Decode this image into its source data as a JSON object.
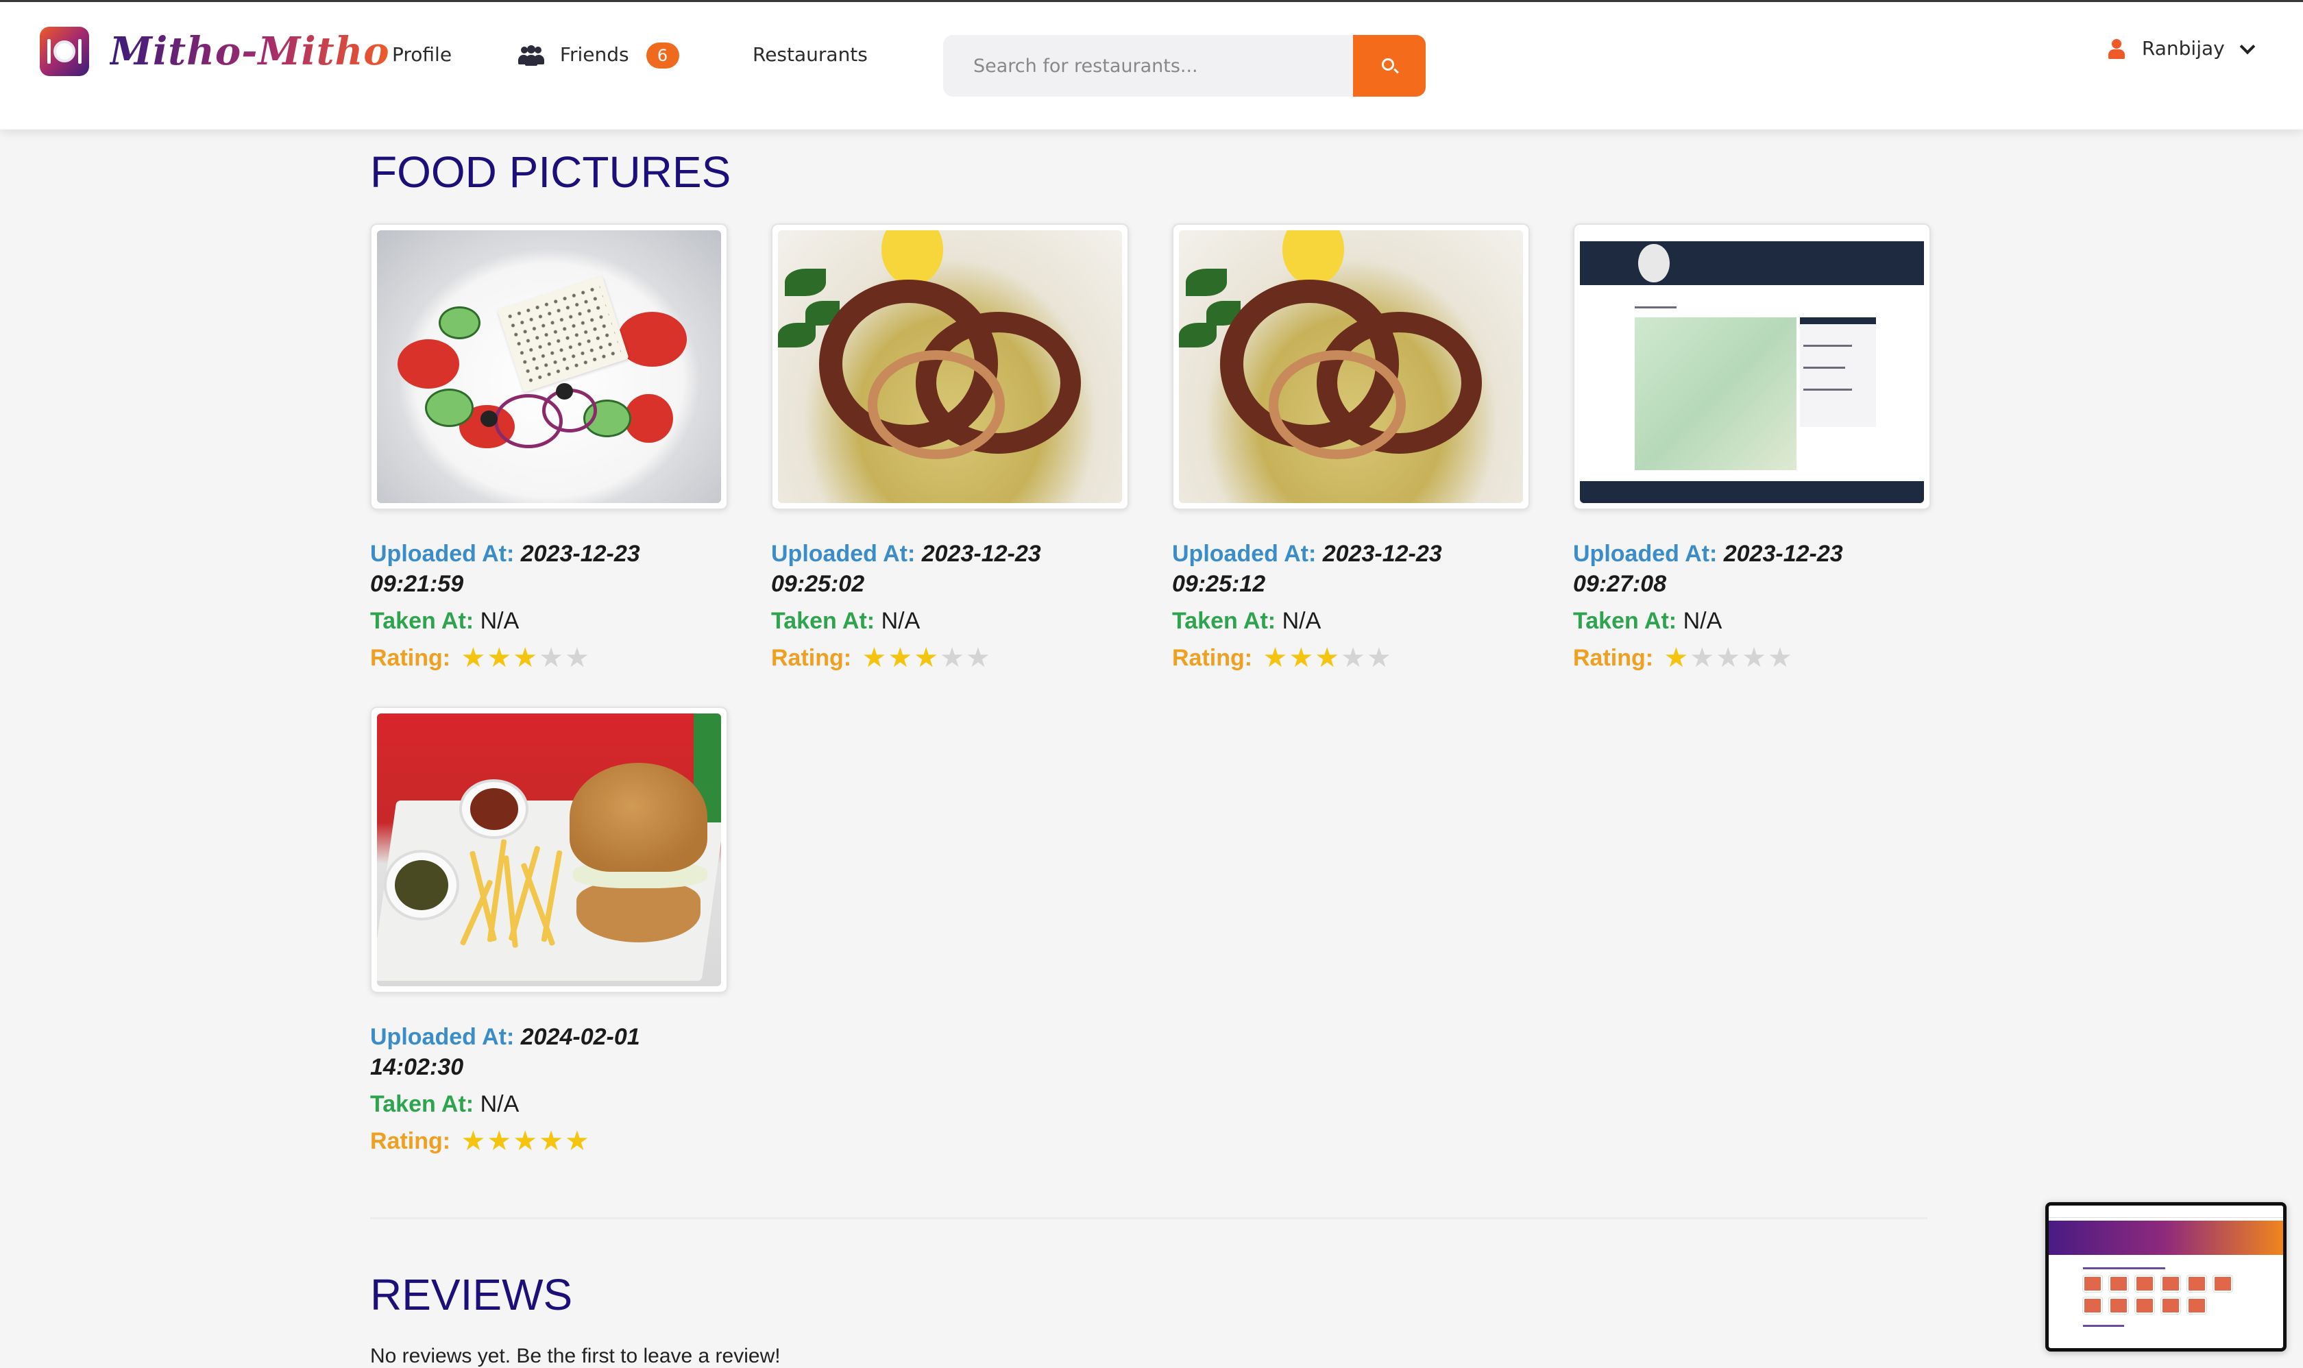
{
  "app": {
    "brand": "Mitho-Mitho"
  },
  "nav": {
    "profile": "Profile",
    "friends": "Friends",
    "friends_count": "6",
    "restaurants": "Restaurants",
    "search_placeholder": "Search for restaurants...",
    "user": "Ranbijay"
  },
  "food_pictures": {
    "title": "FOOD PICTURES",
    "labels": {
      "uploaded": "Uploaded At:",
      "taken": "Taken At:",
      "rating": "Rating:"
    },
    "items": [
      {
        "image": "greek-salad",
        "uploaded_date": "2023-12-23",
        "uploaded_time": "09:21:59",
        "taken": "N/A",
        "rating": 3,
        "rating_max": 5
      },
      {
        "image": "grilled-octopus",
        "uploaded_date": "2023-12-23",
        "uploaded_time": "09:25:02",
        "taken": "N/A",
        "rating": 3,
        "rating_max": 5
      },
      {
        "image": "grilled-octopus",
        "uploaded_date": "2023-12-23",
        "uploaded_time": "09:25:12",
        "taken": "N/A",
        "rating": 3,
        "rating_max": 5
      },
      {
        "image": "profile-map-screenshot",
        "uploaded_date": "2023-12-23",
        "uploaded_time": "09:27:08",
        "taken": "N/A",
        "rating": 1,
        "rating_max": 5
      },
      {
        "image": "burger-and-fries",
        "uploaded_date": "2024-02-01",
        "uploaded_time": "14:02:30",
        "taken": "N/A",
        "rating": 5,
        "rating_max": 5
      }
    ]
  },
  "reviews": {
    "title": "REVIEWS",
    "empty_text": "No reviews yet. Be the first to leave a review!"
  },
  "colors": {
    "accent": "#f46b1c",
    "heading": "#1d0f7a",
    "uploaded_label": "#3a8dc8",
    "taken_label": "#2ea44f",
    "rating_label": "#f0a020",
    "star_on": "#f5c40f",
    "star_off": "#d4d4d4"
  },
  "icons": {
    "search": "search-icon",
    "friends": "users-icon",
    "user": "user-icon",
    "dropdown": "chevron-down-icon",
    "star": "star-icon"
  }
}
